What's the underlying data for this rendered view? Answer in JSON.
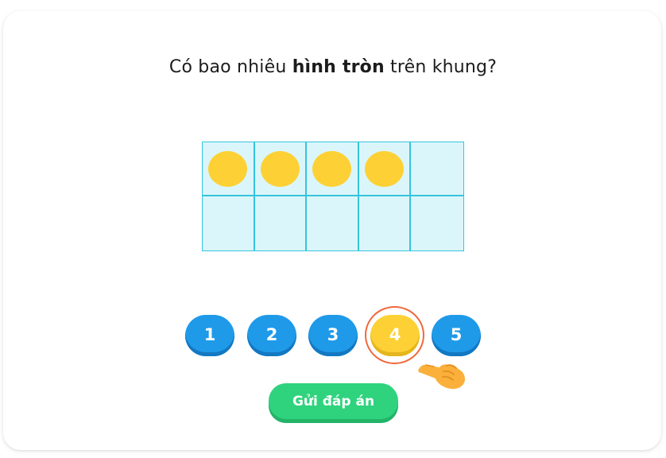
{
  "question": {
    "prefix": "Có bao nhiêu",
    "emphasis": "hình tròn",
    "suffix": "trên khung?"
  },
  "ten_frame": {
    "columns": 5,
    "rows": 2,
    "filled_count": 4,
    "cell_color": "#dbf6fb",
    "border_color": "#35c4dd",
    "dot_color": "#fdd135"
  },
  "choices": {
    "items": [
      "1",
      "2",
      "3",
      "4",
      "5"
    ],
    "selected": "4",
    "button_color": "#1f9ae8",
    "selected_color": "#fdd135"
  },
  "hint": {
    "icon": "pointing-hand-icon",
    "highlight_color": "#f0683c"
  },
  "submit": {
    "label": "Gửi đáp án",
    "color": "#2fd37e"
  }
}
